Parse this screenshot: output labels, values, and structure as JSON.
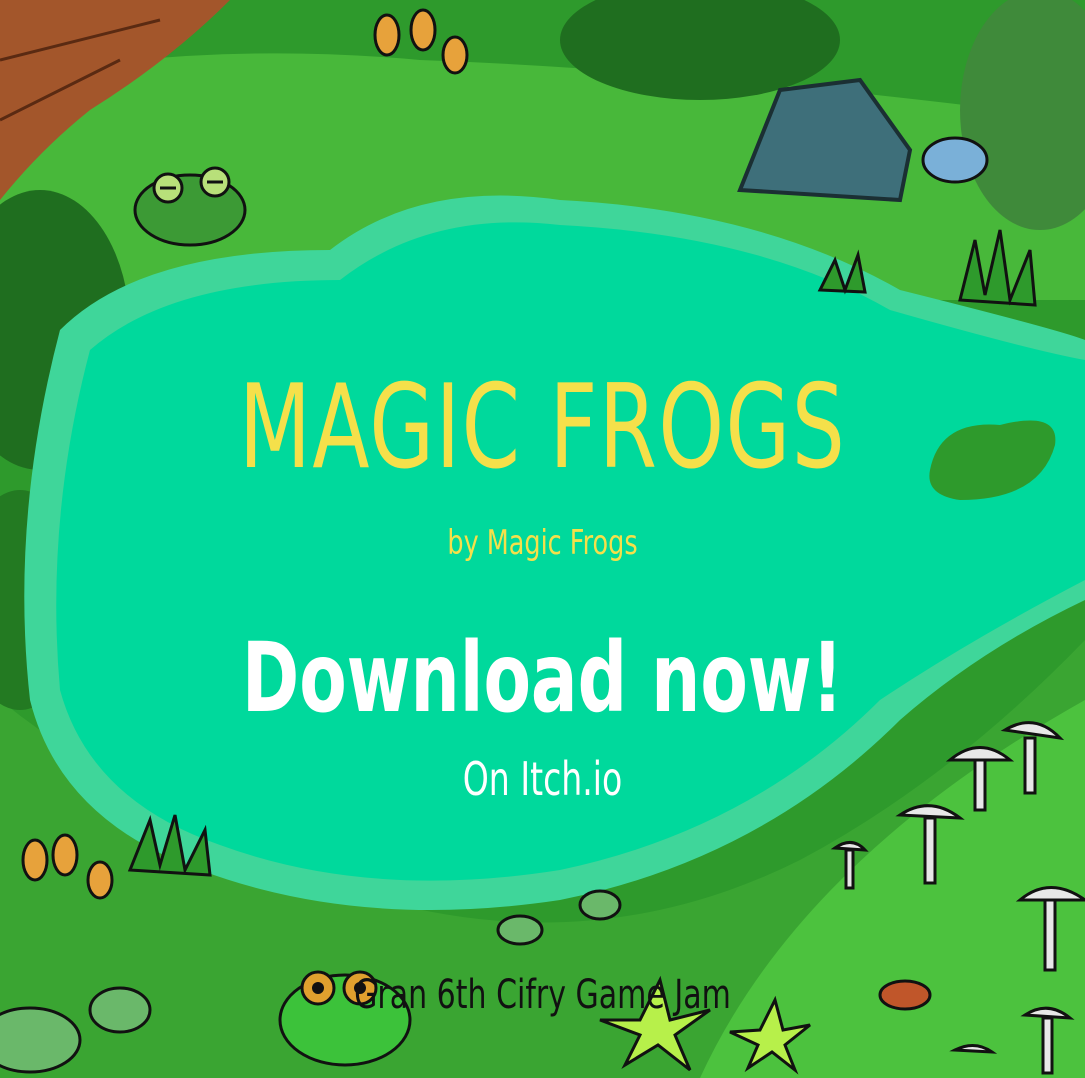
{
  "title": "MAGIC FROGS",
  "byline": "by Magic Frogs",
  "call_to_action": "Download now!",
  "platform": "On Itch.io",
  "event": "Gran 6th Cifry Game Jam",
  "colors": {
    "pond": "#00d99c",
    "pond_edge": "#3fe0a0",
    "grass": "#2e9a2c",
    "dark_foliage": "#1f6e1f",
    "title_yellow": "#f5e04a",
    "cta_white": "#ffffff"
  }
}
